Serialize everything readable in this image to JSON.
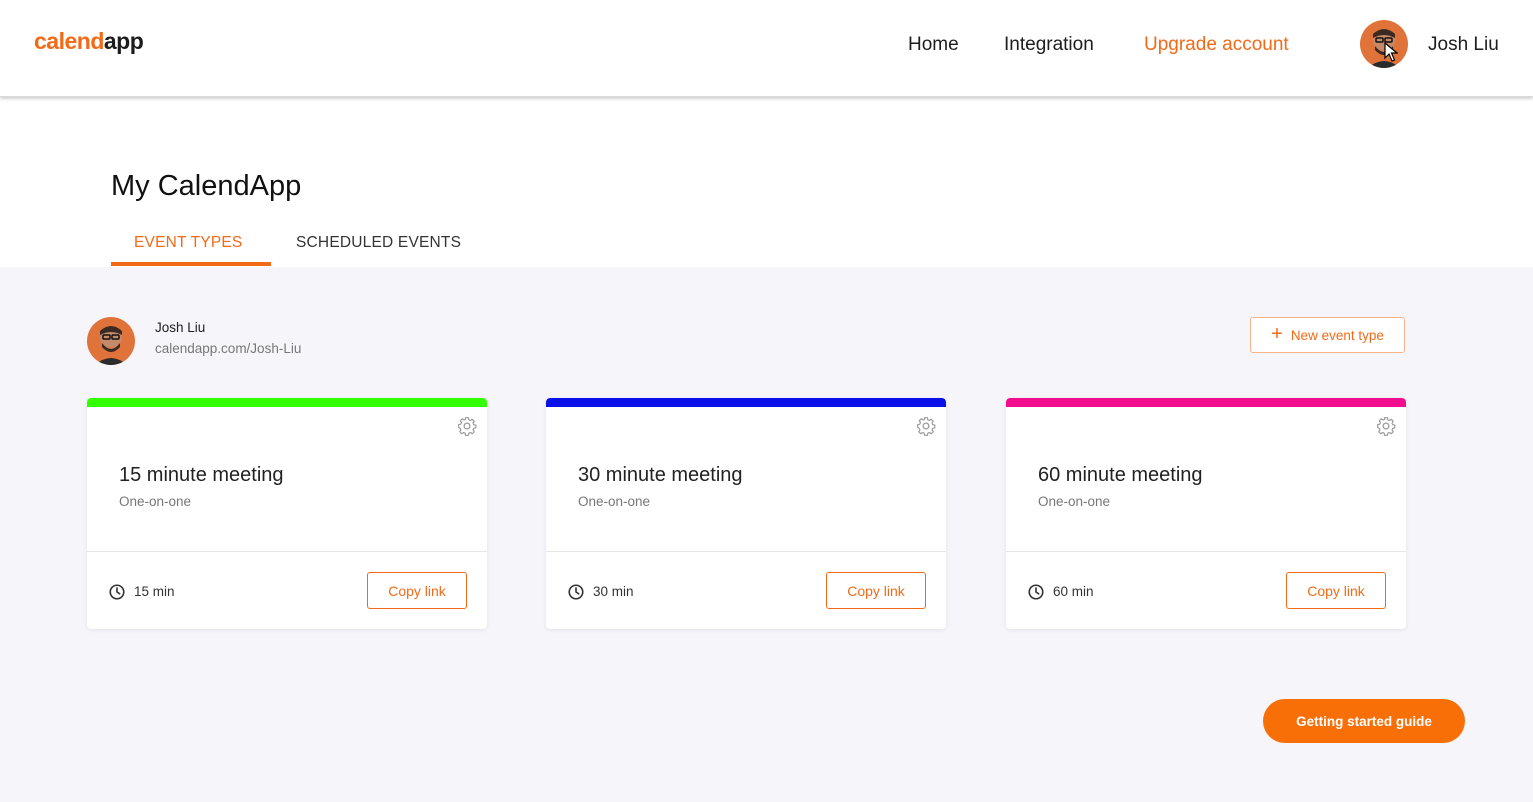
{
  "header": {
    "logo_part1": "calend",
    "logo_part2": "app",
    "nav": {
      "home": "Home",
      "integration": "Integration",
      "upgrade": "Upgrade account"
    },
    "user_name": "Josh Liu"
  },
  "page": {
    "title": "My CalendApp",
    "tabs": [
      {
        "label": "EVENT TYPES",
        "active": true
      },
      {
        "label": "SCHEDULED EVENTS",
        "active": false
      }
    ]
  },
  "profile": {
    "name": "Josh Liu",
    "url": "calendapp.com/Josh-Liu",
    "new_event_label": "New event type"
  },
  "events": [
    {
      "title": "15 minute meeting",
      "subtitle": "One-on-one",
      "duration": "15 min",
      "copy_label": "Copy link",
      "color": "#33ff00"
    },
    {
      "title": "30 minute meeting",
      "subtitle": "One-on-one",
      "duration": "30 min",
      "copy_label": "Copy link",
      "color": "#0a10e8"
    },
    {
      "title": "60 minute meeting",
      "subtitle": "One-on-one",
      "duration": "60 min",
      "copy_label": "Copy link",
      "color": "#f20d8f"
    }
  ],
  "guide_button": "Getting started guide",
  "colors": {
    "accent": "#f26a16",
    "content_bg": "#f5f5fa"
  },
  "icons": [
    "avatar",
    "cursor-icon",
    "plus-icon",
    "gear-icon",
    "clock-icon"
  ]
}
